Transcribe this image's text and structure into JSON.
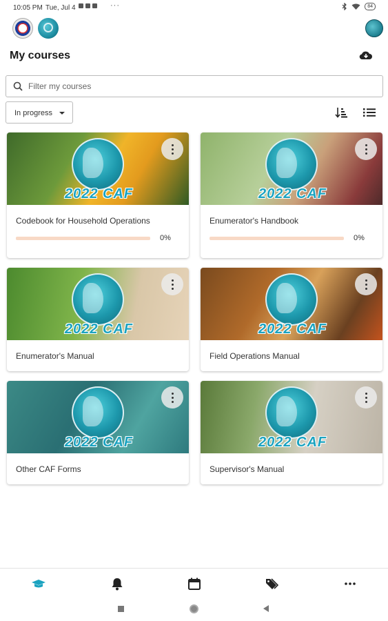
{
  "status_bar": {
    "time": "10:05 PM",
    "date": "Tue, Jul 4",
    "overflow": "···",
    "battery": "84"
  },
  "header": {
    "title": "My courses"
  },
  "search": {
    "placeholder": "Filter my courses"
  },
  "filter": {
    "selected": "In progress"
  },
  "courses": [
    {
      "name": "Codebook for Household Operations",
      "progress": 0,
      "progress_label": "0%",
      "brand": "2022 CAF"
    },
    {
      "name": "Enumerator's Handbook",
      "progress": 0,
      "progress_label": "0%",
      "brand": "2022 CAF"
    },
    {
      "name": "Enumerator's Manual",
      "brand": "2022 CAF"
    },
    {
      "name": "Field Operations Manual",
      "brand": "2022 CAF"
    },
    {
      "name": "Other CAF Forms",
      "brand": "2022 CAF"
    },
    {
      "name": "Supervisor's Manual",
      "brand": "2022 CAF"
    }
  ],
  "bottom_nav": [
    {
      "name": "my-courses",
      "icon": "graduation-cap-icon",
      "active": true
    },
    {
      "name": "notifications",
      "icon": "bell-icon"
    },
    {
      "name": "calendar",
      "icon": "calendar-icon"
    },
    {
      "name": "tags",
      "icon": "tags-icon"
    },
    {
      "name": "more",
      "icon": "more-horizontal-icon"
    }
  ],
  "colors": {
    "accent": "#1ba3c0",
    "progress_track": "#f8d9c6",
    "nav_active": "#1ba3c0"
  }
}
